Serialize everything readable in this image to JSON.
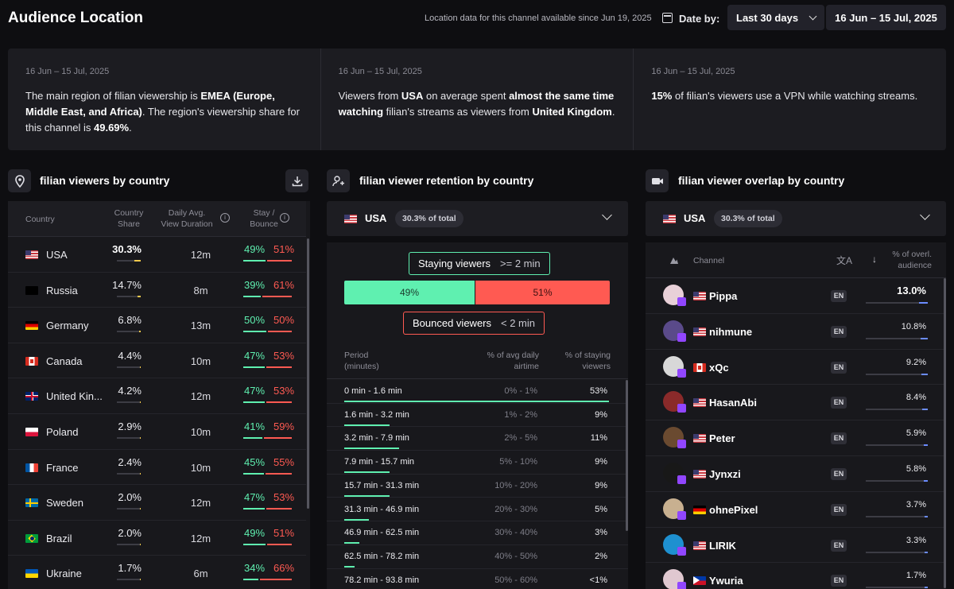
{
  "header": {
    "title": "Audience Location",
    "note": "Location data for this channel available since Jun 19, 2025",
    "date_by_label": "Date by:",
    "range_select": "Last 30 days",
    "date_range": "16 Jun – 15 Jul, 2025"
  },
  "insights": [
    {
      "date": "16 Jun – 15 Jul, 2025",
      "p1": "The main region of filian viewership is ",
      "b1": "EMEA (Europe, Middle East, and Africa)",
      "p2": ". The region's viewership share for this channel is ",
      "b2": "49.69%",
      "p3": ".",
      "b3": "",
      "p4": "",
      "b4": "",
      "p5": ""
    },
    {
      "date": "16 Jun – 15 Jul, 2025",
      "p1": "Viewers from ",
      "b1": "USA",
      "p2": " on average spent ",
      "b2": "almost the same time watching",
      "p3": " filian's streams as viewers from ",
      "b3": "United Kingdom",
      "p4": ".",
      "b4": "",
      "p5": ""
    },
    {
      "date": "16 Jun – 15 Jul, 2025",
      "p1": "",
      "b1": "15%",
      "p2": " of filian's viewers use a VPN while watching streams.",
      "b2": "",
      "p3": "",
      "b3": "",
      "p4": "",
      "b4": "",
      "p5": ""
    }
  ],
  "country_section": {
    "title": "filian viewers by country",
    "col_country": "Country",
    "col_share_1": "Country",
    "col_share_2": "Share",
    "col_dur_1": "Daily Avg.",
    "col_dur_2": "View Duration",
    "col_stay_1": "Stay /",
    "col_stay_2": "Bounce",
    "rows": [
      {
        "name": "USA",
        "flag": "us",
        "share": "30.3%",
        "share_val": 30.3,
        "duration": "12m",
        "stay": "49%",
        "bounce": "51%"
      },
      {
        "name": "Russia",
        "flag": "ru",
        "share": "14.7%",
        "share_val": 14.7,
        "duration": "8m",
        "stay": "39%",
        "bounce": "61%"
      },
      {
        "name": "Germany",
        "flag": "de",
        "share": "6.8%",
        "share_val": 6.8,
        "duration": "13m",
        "stay": "50%",
        "bounce": "50%"
      },
      {
        "name": "Canada",
        "flag": "ca",
        "share": "4.4%",
        "share_val": 4.4,
        "duration": "10m",
        "stay": "47%",
        "bounce": "53%"
      },
      {
        "name": "United Kin...",
        "flag": "gb",
        "share": "4.2%",
        "share_val": 4.2,
        "duration": "12m",
        "stay": "47%",
        "bounce": "53%"
      },
      {
        "name": "Poland",
        "flag": "pl",
        "share": "2.9%",
        "share_val": 2.9,
        "duration": "10m",
        "stay": "41%",
        "bounce": "59%"
      },
      {
        "name": "France",
        "flag": "fr",
        "share": "2.4%",
        "share_val": 2.4,
        "duration": "10m",
        "stay": "45%",
        "bounce": "55%"
      },
      {
        "name": "Sweden",
        "flag": "se",
        "share": "2.0%",
        "share_val": 2.0,
        "duration": "12m",
        "stay": "47%",
        "bounce": "53%"
      },
      {
        "name": "Brazil",
        "flag": "br",
        "share": "2.0%",
        "share_val": 2.0,
        "duration": "12m",
        "stay": "49%",
        "bounce": "51%"
      },
      {
        "name": "Ukraine",
        "flag": "ua",
        "share": "1.7%",
        "share_val": 1.7,
        "duration": "6m",
        "stay": "34%",
        "bounce": "66%"
      }
    ]
  },
  "retention_section": {
    "title": "filian viewer retention by country",
    "country": "USA",
    "country_share": "30.3% of total",
    "staying_label": "Staying viewers",
    "staying_rule": ">= 2 min",
    "bounced_label": "Bounced viewers",
    "bounced_rule": "< 2 min",
    "stay_pct": "49%",
    "bounce_pct": "51%",
    "stay_val": 49,
    "col_period_1": "Period",
    "col_period_2": "(minutes)",
    "col_airtime_1": "% of avg daily",
    "col_airtime_2": "airtime",
    "col_staying_1": "% of staying",
    "col_staying_2": "viewers",
    "rows": [
      {
        "period": "0 min - 1.6 min",
        "airtime": "0% - 1%",
        "staying": "53%",
        "val": 53
      },
      {
        "period": "1.6 min - 3.2 min",
        "airtime": "1% - 2%",
        "staying": "9%",
        "val": 9
      },
      {
        "period": "3.2 min - 7.9 min",
        "airtime": "2% - 5%",
        "staying": "11%",
        "val": 11
      },
      {
        "period": "7.9 min - 15.7 min",
        "airtime": "5% - 10%",
        "staying": "9%",
        "val": 9
      },
      {
        "period": "15.7 min - 31.3 min",
        "airtime": "10% - 20%",
        "staying": "9%",
        "val": 9
      },
      {
        "period": "31.3 min - 46.9 min",
        "airtime": "20% - 30%",
        "staying": "5%",
        "val": 5
      },
      {
        "period": "46.9 min - 62.5 min",
        "airtime": "30% - 40%",
        "staying": "3%",
        "val": 3
      },
      {
        "period": "62.5 min - 78.2 min",
        "airtime": "40% - 50%",
        "staying": "2%",
        "val": 2
      },
      {
        "period": "78.2 min - 93.8 min",
        "airtime": "50% - 60%",
        "staying": "<1%",
        "val": 0.5
      }
    ]
  },
  "overlap_section": {
    "title": "filian viewer overlap by country",
    "country": "USA",
    "country_share": "30.3% of total",
    "col_channel": "Channel",
    "col_overlap_1": "% of overl.",
    "col_overlap_2": "audience",
    "rows": [
      {
        "name": "Pippa",
        "flag": "us",
        "lang": "EN",
        "pct": "13.0%",
        "val": 13.0,
        "avatar": "#e8d0d8"
      },
      {
        "name": "nihmune",
        "flag": "us",
        "lang": "EN",
        "pct": "10.8%",
        "val": 10.8,
        "avatar": "#5a4a8a"
      },
      {
        "name": "xQc",
        "flag": "ca",
        "lang": "EN",
        "pct": "9.2%",
        "val": 9.2,
        "avatar": "#d8d8d8"
      },
      {
        "name": "HasanAbi",
        "flag": "us",
        "lang": "EN",
        "pct": "8.4%",
        "val": 8.4,
        "avatar": "#8a2a2a"
      },
      {
        "name": "Peter",
        "flag": "us",
        "lang": "EN",
        "pct": "5.9%",
        "val": 5.9,
        "avatar": "#6a4a30"
      },
      {
        "name": "Jynxzi",
        "flag": "us",
        "lang": "EN",
        "pct": "5.8%",
        "val": 5.8,
        "avatar": "#181818"
      },
      {
        "name": "ohnePixel",
        "flag": "de",
        "lang": "EN",
        "pct": "3.7%",
        "val": 3.7,
        "avatar": "#c8b090"
      },
      {
        "name": "LIRIK",
        "flag": "us",
        "lang": "EN",
        "pct": "3.3%",
        "val": 3.3,
        "avatar": "#1e90d0"
      },
      {
        "name": "Ywuria",
        "flag": "ph",
        "lang": "EN",
        "pct": "1.7%",
        "val": 1.7,
        "avatar": "#e0c8d0"
      }
    ]
  },
  "colors": {
    "stay": "#5ff0b0",
    "bounce": "#ff5a52",
    "share_bar": "#f2c94c",
    "overlap_bar": "#6b8cff",
    "twitch": "#9146ff"
  }
}
